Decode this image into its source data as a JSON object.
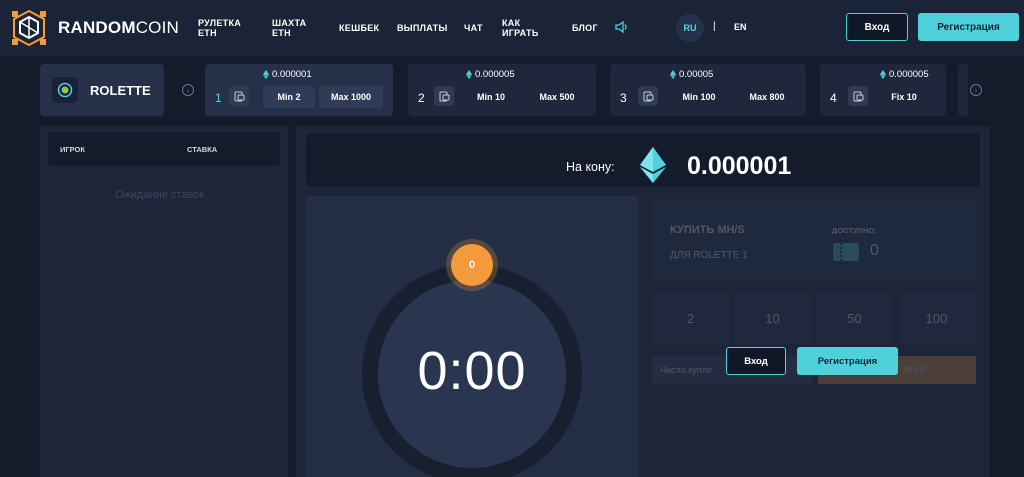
{
  "brand": {
    "name_bold": "RANDOM",
    "name_light": "COIN"
  },
  "nav": {
    "items": [
      {
        "line1": "РУЛЕТКА",
        "line2": "ETH"
      },
      {
        "line1": "ШАХТА",
        "line2": "ETH"
      },
      {
        "line1": "КЕШБЕК",
        "line2": ""
      },
      {
        "line1": "ВЫПЛАТЫ",
        "line2": ""
      },
      {
        "line1": "ЧАТ",
        "line2": ""
      },
      {
        "line1": "КАК",
        "line2": "ИГРАТЬ"
      },
      {
        "line1": "БЛОГ",
        "line2": ""
      }
    ],
    "sound_icon": "speaker-icon",
    "languages": {
      "active": "RU",
      "separator": "|",
      "other": "EN"
    },
    "login_label": "Вход",
    "register_label": "Регистрация"
  },
  "game": {
    "title": "ROLETTE",
    "icon": "rolette-icon"
  },
  "rooms": [
    {
      "number": "1",
      "price": "0.000001",
      "min": "Min 2",
      "max": "Max 1000",
      "active": true
    },
    {
      "number": "2",
      "price": "0.000005",
      "min": "Min 10",
      "max": "Max 500",
      "active": false
    },
    {
      "number": "3",
      "price": "0.00005",
      "min": "Min 100",
      "max": "Max 800",
      "active": false
    },
    {
      "number": "4",
      "price": "0.000005",
      "fix": "Fix 10",
      "active": false
    }
  ],
  "players": {
    "col_player": "ИГРОК",
    "col_bet": "СТАВКА",
    "waiting": "Ожидание ставок"
  },
  "bet": {
    "label": "На кону:",
    "value": "0.000001",
    "currency_icon": "ethereum-icon"
  },
  "timer": {
    "time": "0:00",
    "count": "0"
  },
  "buy": {
    "title": "КУПИТЬ MH/S",
    "subtitle": "ДЛЯ ROLETTE 1",
    "available_label": "ДОСТУПНО:",
    "available_value": "0",
    "quantities": [
      "2",
      "10",
      "50",
      "100"
    ],
    "input_placeholder": "Число купле",
    "button_label": "MH/S"
  },
  "overlay": {
    "login_label": "Вход",
    "register_label": "Регистрация"
  },
  "colors": {
    "accent": "#4fd1dc",
    "orange": "#f39a3c",
    "background": "#141b2b",
    "panel": "#1d2639"
  }
}
